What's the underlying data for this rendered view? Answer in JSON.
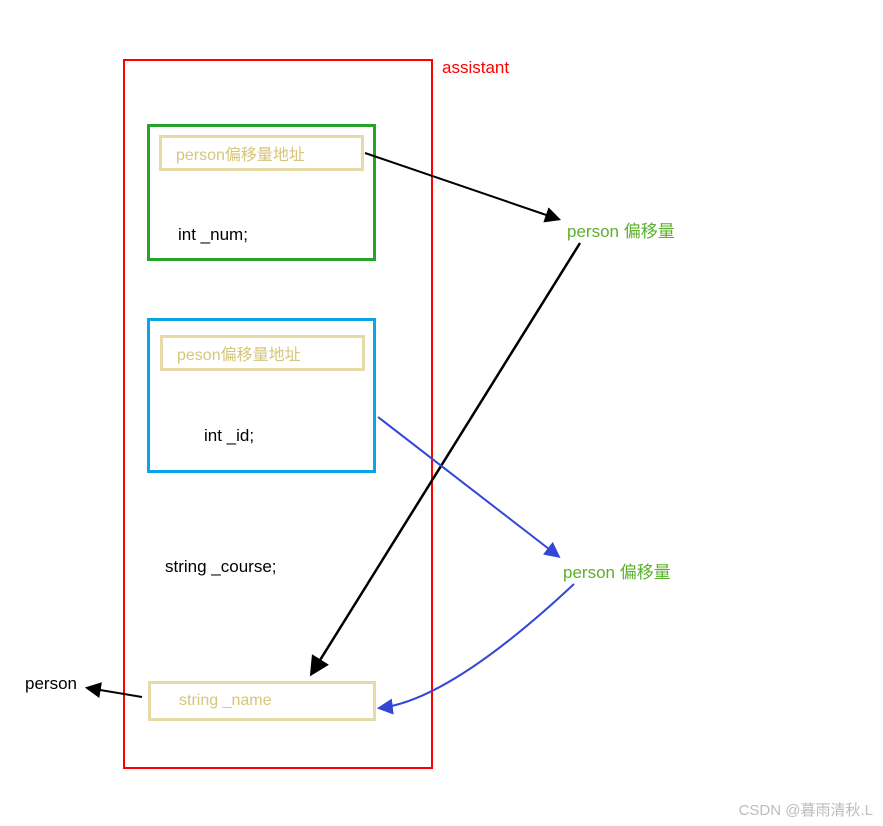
{
  "labels": {
    "assistant": "assistant",
    "person_offset_1": "person 偏移量",
    "person_offset_2": "person 偏移量",
    "person": "person"
  },
  "green_box": {
    "addr_label": "person偏移量地址",
    "field": "int _num;"
  },
  "blue_box": {
    "addr_label": "peson偏移量地址",
    "field": "int _id;"
  },
  "course_field": "string _course;",
  "name_box": {
    "label": "string _name"
  },
  "watermark": "CSDN @暮雨清秋.L",
  "colors": {
    "red": "#ff0000",
    "green_border": "#27a32a",
    "blue_border": "#0aa5e8",
    "gold_border": "#e6dba7",
    "green_text": "#5cb02c",
    "arrow_blue": "#3247d8",
    "arrow_black": "#000000"
  }
}
